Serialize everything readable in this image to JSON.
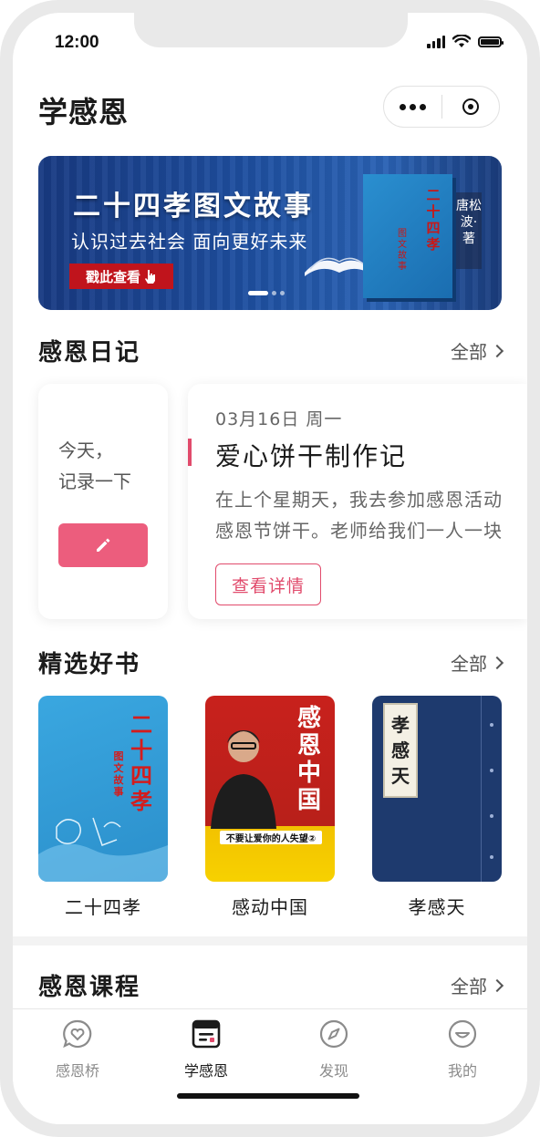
{
  "status_bar": {
    "time": "12:00"
  },
  "header": {
    "title": "学感恩"
  },
  "banner": {
    "title": "二十四孝图文故事",
    "subtitle": "认识过去社会 面向更好未来",
    "button_label": "戳此查看",
    "book_title": "二十四孝",
    "book_subtitle": "图文故事",
    "author": "唐松波·著"
  },
  "diary": {
    "section_title": "感恩日记",
    "more_label": "全部",
    "prompt_line1": "今天，",
    "prompt_line2": "记录一下",
    "entry": {
      "date": "03月16日 周一",
      "title": "爱心饼干制作记",
      "body_line1": "在上个星期天，我去参加感恩活动",
      "body_line2": "感恩节饼干。老师给我们一人一块",
      "detail_label": "查看详情"
    }
  },
  "books": {
    "section_title": "精选好书",
    "more_label": "全部",
    "items": [
      {
        "name": "二十四孝",
        "cover_text": "二十四孝",
        "cover_sub": "图文故事"
      },
      {
        "name": "感动中国",
        "cover_text": "感恩中国",
        "cover_sub": "不要让爱你的人失望②"
      },
      {
        "name": "孝感天",
        "cover_text": "孝感天"
      }
    ]
  },
  "courses": {
    "section_title": "感恩课程",
    "more_label": "全部"
  },
  "tabbar": {
    "items": [
      {
        "label": "感恩桥",
        "icon": "heart-chat-icon"
      },
      {
        "label": "学感恩",
        "icon": "book-icon"
      },
      {
        "label": "发现",
        "icon": "compass-icon"
      },
      {
        "label": "我的",
        "icon": "smile-icon"
      }
    ],
    "active": 1
  },
  "colors": {
    "accent": "#e14b6c",
    "button_pink": "#ec5d7d",
    "banner_blue": "#1e4fa0"
  }
}
